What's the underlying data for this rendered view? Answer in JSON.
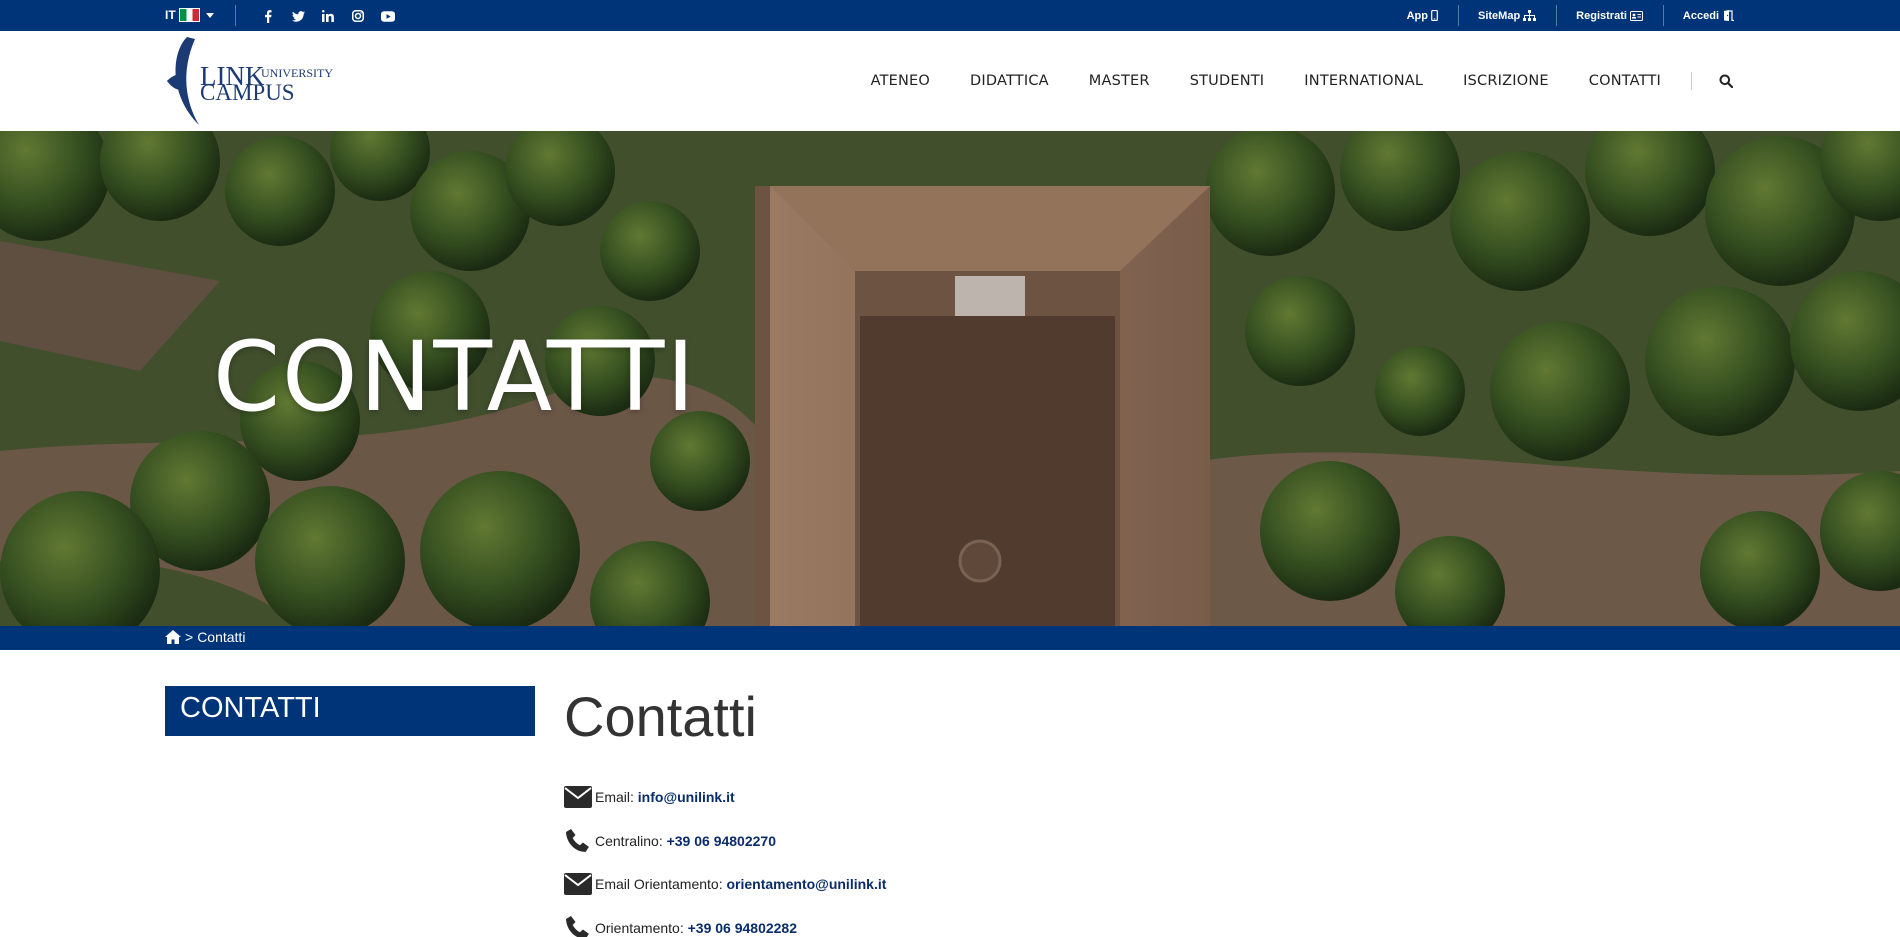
{
  "topbar": {
    "language": "IT",
    "social_icons": [
      "facebook-icon",
      "twitter-icon",
      "linkedin-icon",
      "instagram-icon",
      "youtube-icon"
    ],
    "links": [
      {
        "label": "App",
        "icon": "mobile-icon"
      },
      {
        "label": "SiteMap",
        "icon": "sitemap-icon"
      },
      {
        "label": "Registrati",
        "icon": "id-card-icon"
      },
      {
        "label": "Accedi",
        "icon": "door-icon"
      }
    ]
  },
  "header": {
    "logo": {
      "line1": "LINK",
      "sup": "UNIVERSITY",
      "line2": "CAMPUS"
    },
    "nav": [
      "ATENEO",
      "DIDATTICA",
      "MASTER",
      "STUDENTI",
      "INTERNATIONAL",
      "ISCRIZIONE",
      "CONTATTI"
    ],
    "search_icon": "search-icon"
  },
  "hero": {
    "title": "CONTATTI"
  },
  "breadcrumb": {
    "separator": ">",
    "current": "Contatti"
  },
  "sidebar": {
    "title": "CONTATTI"
  },
  "main": {
    "title": "Contatti",
    "contacts": [
      {
        "icon": "envelope-icon",
        "label": "Email:",
        "value": "info@unilink.it"
      },
      {
        "icon": "phone-icon",
        "label": "Centralino:",
        "value": "+39 06 94802270"
      },
      {
        "icon": "envelope-icon",
        "label": "Email Orientamento:",
        "value": "orientamento@unilink.it"
      },
      {
        "icon": "phone-icon",
        "label": "Orientamento:",
        "value": "+39 06 94802282"
      }
    ]
  },
  "colors": {
    "brand": "#003478",
    "link": "#0a2c6b",
    "text": "#333333"
  }
}
